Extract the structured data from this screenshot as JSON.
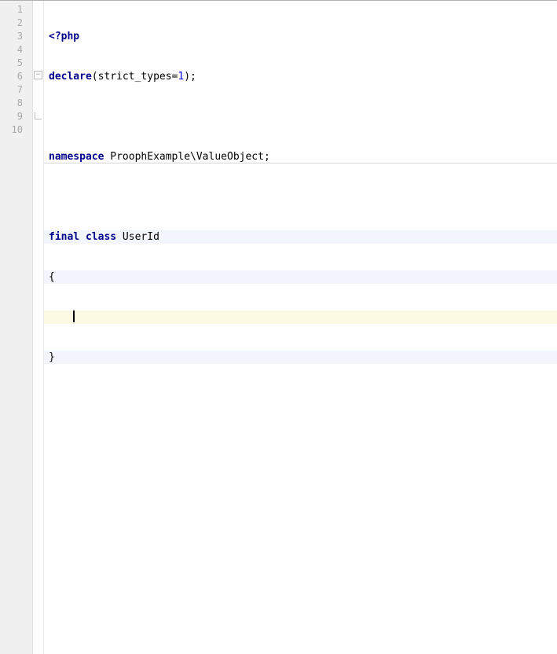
{
  "gutter": {
    "lines": [
      "1",
      "2",
      "3",
      "4",
      "5",
      "6",
      "7",
      "8",
      "9",
      "10"
    ]
  },
  "code": {
    "l1_open": "<?php",
    "l2_kw": "declare",
    "l2_rest_a": "(strict_types=",
    "l2_num": "1",
    "l2_rest_b": ");",
    "l3": "",
    "l4_kw": "namespace",
    "l4_ns": " ProophExample\\ValueObject;",
    "l5": "",
    "l6_kw1": "final",
    "l6_sp1": " ",
    "l6_kw2": "class",
    "l6_name": " UserId",
    "l7": "{",
    "l8_indent": "    ",
    "l9": "}",
    "l10": ""
  }
}
